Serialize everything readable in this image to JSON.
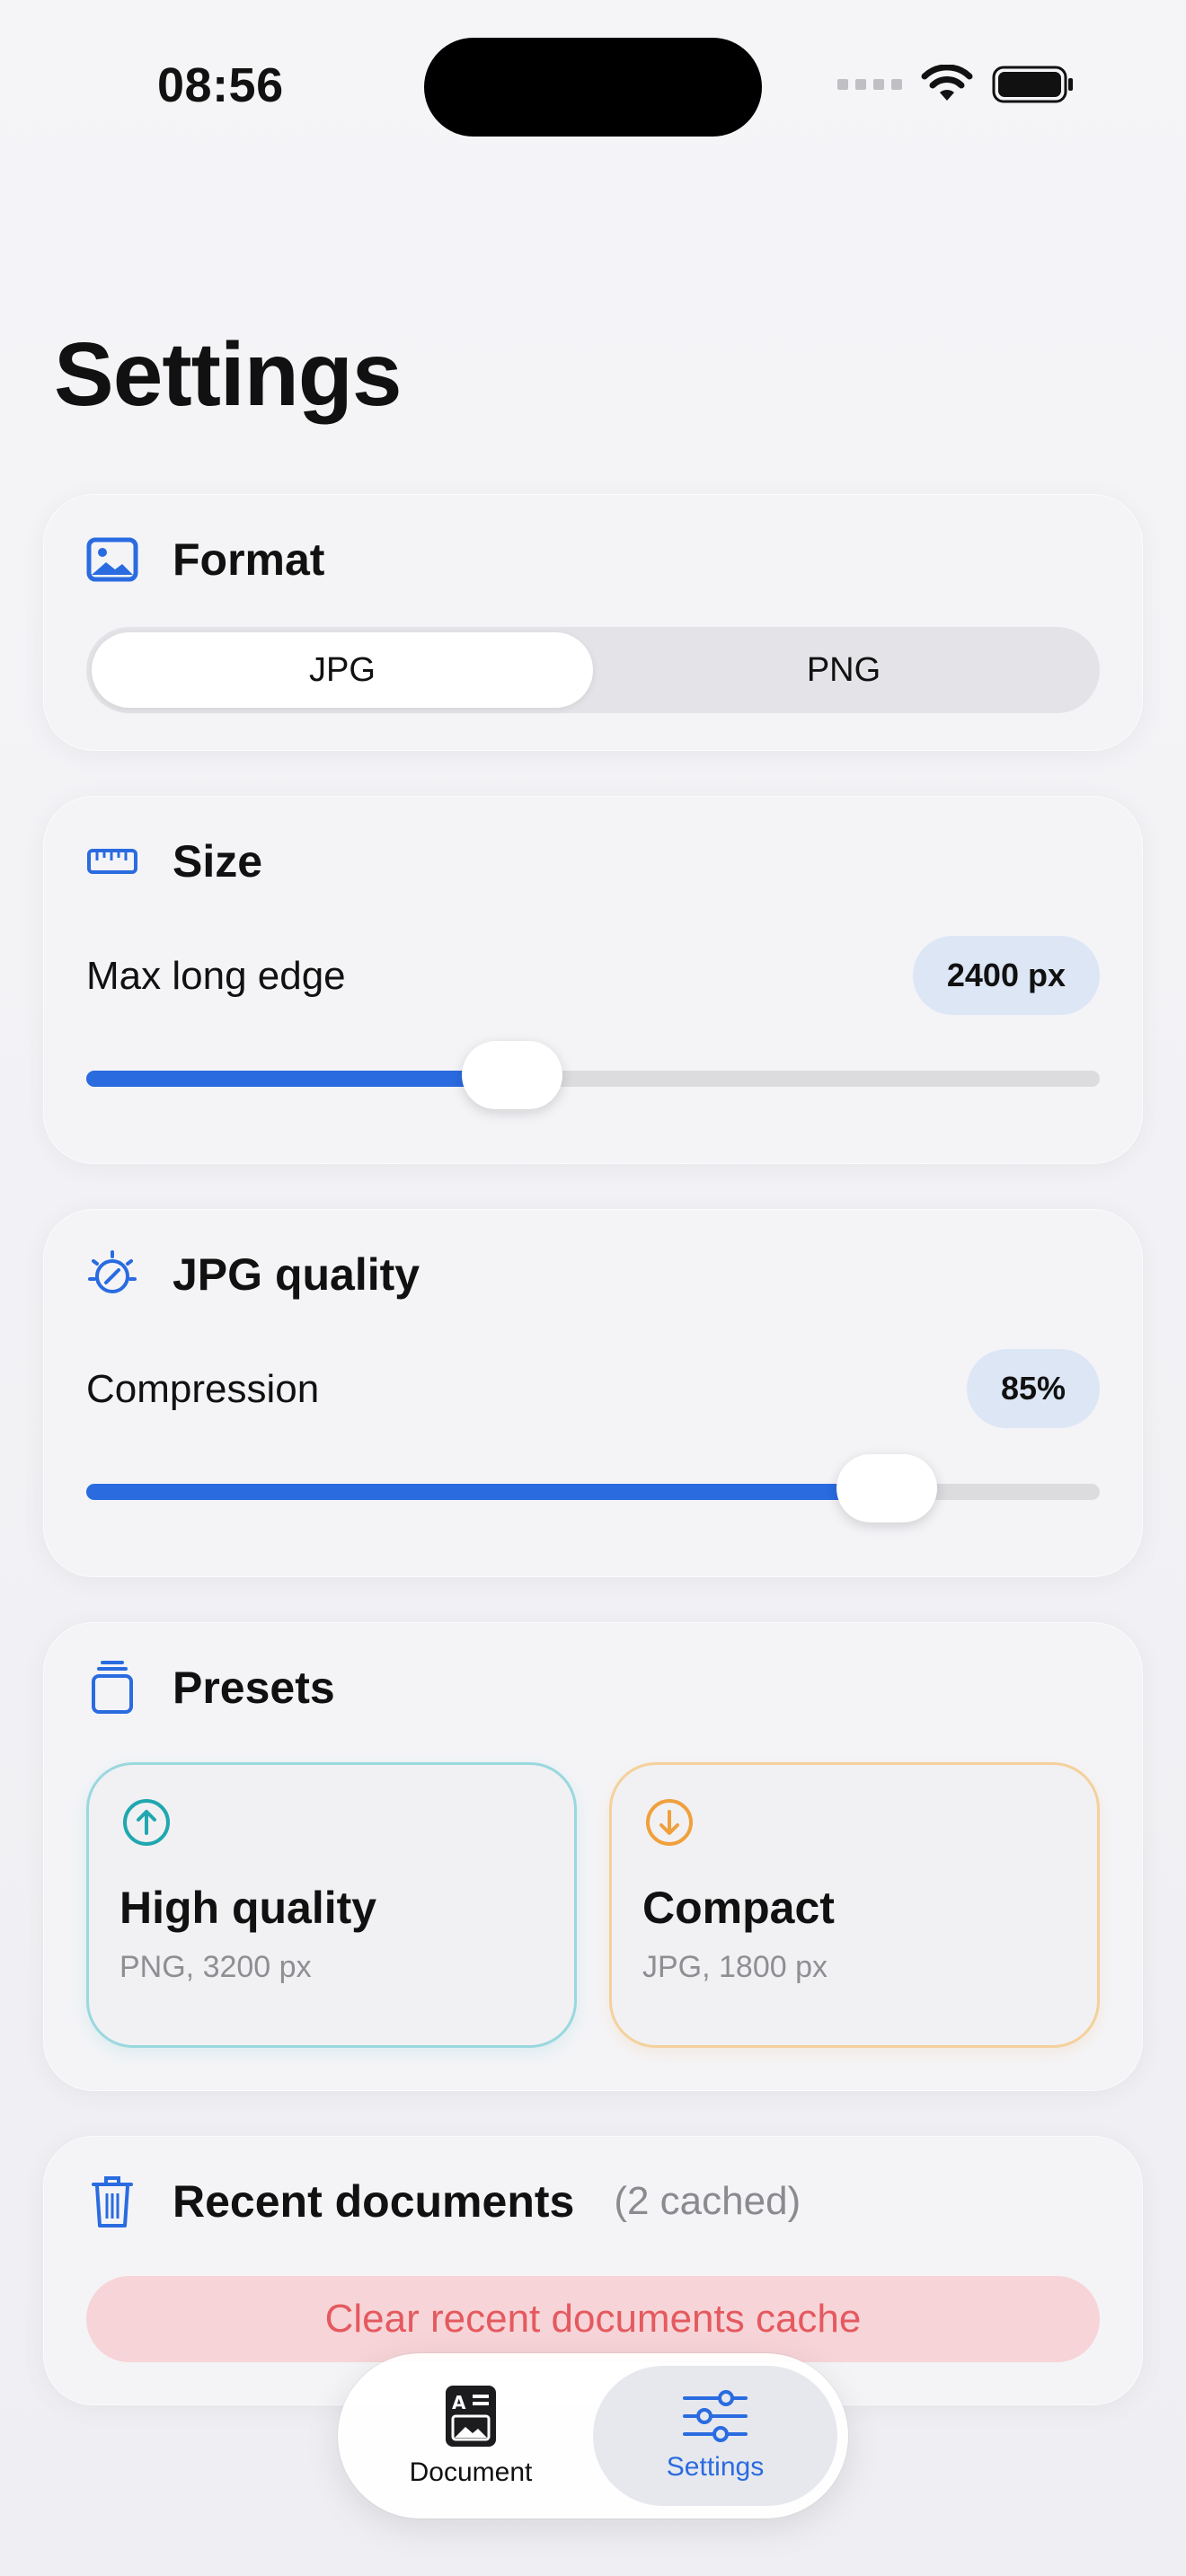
{
  "status": {
    "time": "08:56"
  },
  "page": {
    "title": "Settings"
  },
  "format": {
    "title": "Format",
    "options": [
      "JPG",
      "PNG"
    ],
    "selected": "JPG"
  },
  "size": {
    "title": "Size",
    "label": "Max long edge",
    "value_text": "2400 px",
    "slider_fraction": 0.42
  },
  "quality": {
    "title": "JPG quality",
    "label": "Compression",
    "value_text": "85%",
    "slider_fraction": 0.79
  },
  "presets": {
    "title": "Presets",
    "items": [
      {
        "title": "High quality",
        "subtitle": "PNG, 3200 px",
        "icon": "arrow-up-circle-icon",
        "color": "#20a7b0"
      },
      {
        "title": "Compact",
        "subtitle": "JPG, 1800 px",
        "icon": "arrow-down-circle-icon",
        "color": "#f0a03c"
      }
    ]
  },
  "recent": {
    "title": "Recent documents",
    "subtitle": "(2 cached)",
    "clear_label": "Clear recent documents cache"
  },
  "tabbar": {
    "items": [
      {
        "label": "Document",
        "icon": "document-icon",
        "active": false
      },
      {
        "label": "Settings",
        "icon": "sliders-icon",
        "active": true
      }
    ]
  },
  "colors": {
    "accent": "#2a6be0",
    "danger": "#e45a5f",
    "danger_bg": "#f7d4d8"
  }
}
